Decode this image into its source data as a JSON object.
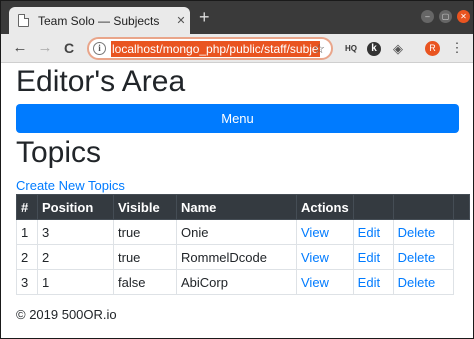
{
  "browser": {
    "tab_title": "Team Solo — Subjects",
    "tab_close": "✕",
    "new_tab": "+",
    "url": "localhost/mongo_php/public/staff/subje",
    "back": "←",
    "forward": "→",
    "reload": "C",
    "star": "☆",
    "extensions": {
      "hq_label": "HQ",
      "k_label": "k",
      "pocket": "◈"
    },
    "avatar_letter": "R",
    "min": "–",
    "max": "▢",
    "close": "✕"
  },
  "page": {
    "title": "Editor's Area",
    "menu_label": "Menu",
    "section_title": "Topics",
    "create_link": "Create New Topics",
    "table": {
      "headers": [
        "#",
        "Position",
        "Visible",
        "Name",
        "Actions"
      ],
      "rows": [
        {
          "id": "1",
          "position": "3",
          "visible": "true",
          "name": "Onie",
          "view": "View",
          "edit": "Edit",
          "delete": "Delete"
        },
        {
          "id": "2",
          "position": "2",
          "visible": "true",
          "name": "RommelDcode",
          "view": "View",
          "edit": "Edit",
          "delete": "Delete"
        },
        {
          "id": "3",
          "position": "1",
          "visible": "false",
          "name": "AbiCorp",
          "view": "View",
          "edit": "Edit",
          "delete": "Delete"
        }
      ]
    },
    "footer": "© 2019 500OR.io"
  },
  "colors": {
    "primary": "#007bff",
    "table_header": "#343a40",
    "accent": "#e95420"
  }
}
